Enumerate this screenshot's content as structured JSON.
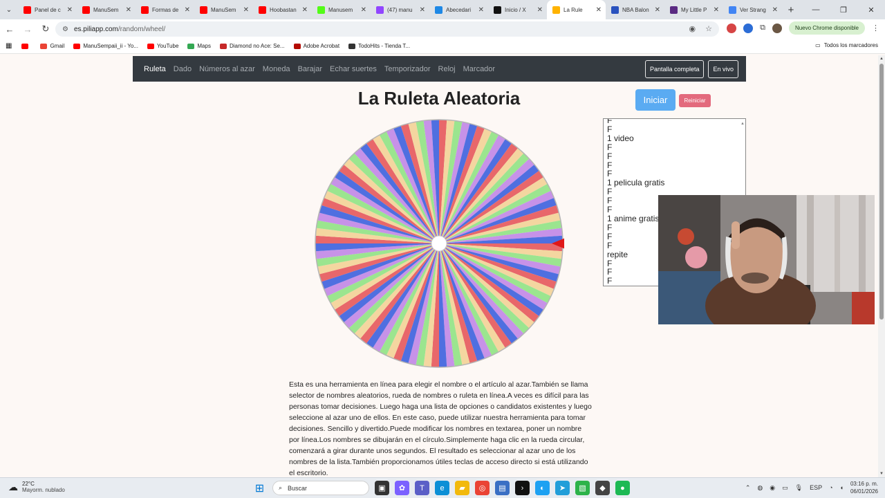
{
  "browser": {
    "tabs": [
      {
        "title": "Panel de c",
        "icon": "youtube-icon",
        "color": "#ff0000"
      },
      {
        "title": "ManuSem",
        "icon": "youtube-icon",
        "color": "#ff0000"
      },
      {
        "title": "Formas de",
        "icon": "youtube-icon",
        "color": "#ff0000"
      },
      {
        "title": "ManuSem",
        "icon": "youtube-icon",
        "color": "#ff0000"
      },
      {
        "title": "Hoobastan",
        "icon": "youtube-icon",
        "color": "#ff0000"
      },
      {
        "title": "Manusem",
        "icon": "kick-icon",
        "color": "#53fc18"
      },
      {
        "title": "(47) manu",
        "icon": "twitch-icon",
        "color": "#9146ff"
      },
      {
        "title": "Abecedari",
        "icon": "dictionary-icon",
        "color": "#1e88e5"
      },
      {
        "title": "Inicio / X",
        "icon": "x-icon",
        "color": "#111111"
      },
      {
        "title": "La Rule",
        "icon": "piliapp-icon",
        "color": "#ffb300",
        "active": true
      },
      {
        "title": "NBA Balon",
        "icon": "nba-icon",
        "color": "#2a52be"
      },
      {
        "title": "My Little P",
        "icon": "mlp-icon",
        "color": "#5a2a82"
      },
      {
        "title": "Ver Strang",
        "icon": "google-icon",
        "color": "#4285f4"
      }
    ],
    "url_host": "es.piliapp.com",
    "url_path": "/random/wheel/",
    "update_label": "Nuevo Chrome disponible",
    "bookmarks": [
      {
        "label": "",
        "icon": "youtube-icon",
        "color": "#ff0000"
      },
      {
        "label": "Gmail",
        "icon": "gmail-icon",
        "color": "#ea4335"
      },
      {
        "label": "ManuSempaii_ii - Yo...",
        "icon": "youtube-icon",
        "color": "#ff0000"
      },
      {
        "label": "YouTube",
        "icon": "youtube-icon",
        "color": "#ff0000"
      },
      {
        "label": "Maps",
        "icon": "maps-icon",
        "color": "#34a853"
      },
      {
        "label": "Diamond no Ace: Se...",
        "icon": "mal-icon",
        "color": "#c62828"
      },
      {
        "label": "Adobe Acrobat",
        "icon": "acrobat-icon",
        "color": "#b30b00"
      },
      {
        "label": "TodoHits - Tienda T...",
        "icon": "todohits-icon",
        "color": "#333333"
      }
    ],
    "all_bookmarks": "Todos los marcadores"
  },
  "site": {
    "nav": [
      "Ruleta",
      "Dado",
      "Números al azar",
      "Moneda",
      "Barajar",
      "Echar suertes",
      "Temporizador",
      "Reloj",
      "Marcador"
    ],
    "nav_active": "Ruleta",
    "btn_fullscreen": "Pantalla completa",
    "btn_live": "En vivo",
    "title": "La Ruleta Aleatoria",
    "btn_start": "Iniciar",
    "btn_reset": "Reiniciar",
    "names": [
      "F",
      "F",
      "1 video",
      "F",
      "F",
      "F",
      "F",
      "1 pelicula gratis",
      "F",
      "F",
      "F",
      "1 anime gratis",
      "F",
      "F",
      "F",
      "repite",
      "F",
      "F",
      "F"
    ],
    "description": "Esta es una herramienta en línea para elegir el nombre o el artículo al azar.También se llama selector de nombres aleatorios, rueda de nombres o ruleta en línea.A veces es difícil para las personas tomar decisiones. Luego haga una lista de opciones o candidatos existentes y luego seleccione al azar uno de ellos. En este caso, puede utilizar nuestra herramienta para tomar decisiones. Sencillo y divertido.Puede modificar los nombres en textarea, poner un nombre por línea.Los nombres se dibujarán en el círculo.Simplemente haga clic en la rueda circular, comenzará a girar durante unos segundos. El resultado es seleccionar al azar uno de los nombres de la lista.También proporcionamos útiles teclas de acceso directo si está utilizando el escritorio."
  },
  "wheel": {
    "segment_count": 100,
    "colors": [
      "#e8676a",
      "#f4d6a0",
      "#9be58f",
      "#c792e8",
      "#4f6fe0"
    ],
    "pointer_color": "#e01818"
  },
  "taskbar": {
    "weather_temp": "22°C",
    "weather_desc": "Mayorm. nublado",
    "search_label": "Buscar",
    "language": "ESP",
    "time": "03:16 p. m.",
    "date": "06/01/2026"
  }
}
